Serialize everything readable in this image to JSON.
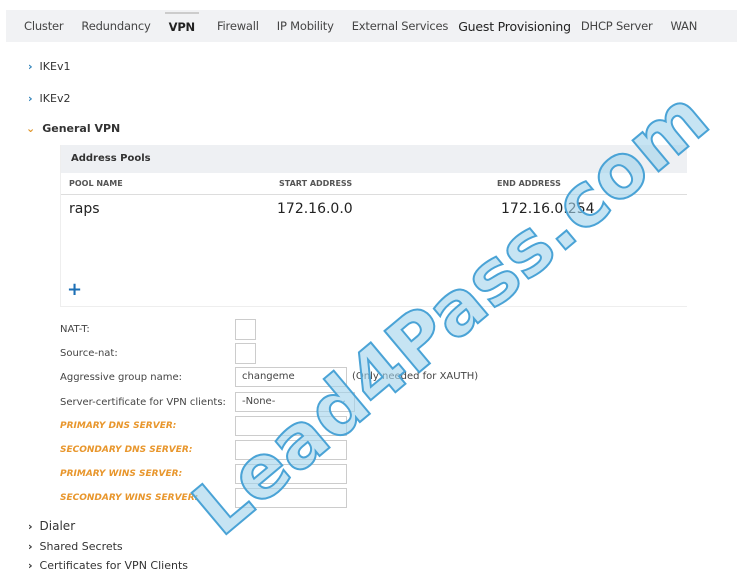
{
  "tabs": [
    "Cluster",
    "Redundancy",
    "VPN",
    "Firewall",
    "IP Mobility",
    "External Services",
    "Guest Provisioning",
    "DHCP Server",
    "WAN"
  ],
  "active_tab": "VPN",
  "sections": {
    "ikev1": "IKEv1",
    "ikev2": "IKEv2",
    "general": "General VPN",
    "dialer": "Dialer",
    "shared": "Shared Secrets",
    "certs": "Certificates for VPN Clients"
  },
  "address_pools": {
    "title": "Address Pools",
    "columns": [
      "POOL NAME",
      "START ADDRESS",
      "END ADDRESS"
    ],
    "rows": [
      [
        "raps",
        "172.16.0.0",
        "172.16.0.254"
      ]
    ],
    "add": "+"
  },
  "form": {
    "nat_t": "NAT-T:",
    "source_nat": "Source-nat:",
    "aggressive": "Aggressive group name:",
    "aggressive_value": "changeme",
    "aggressive_hint": "(Only needed for XAUTH)",
    "server_cert": "Server-certificate for VPN clients:",
    "server_cert_value": "-None-",
    "primary_dns": "PRIMARY DNS SERVER:",
    "secondary_dns": "SECONDARY DNS SERVER:",
    "primary_wins": "PRIMARY WINS SERVER:",
    "secondary_wins": "SECONDARY WINS SERVER:"
  },
  "watermark": "Lead4Pass.com"
}
